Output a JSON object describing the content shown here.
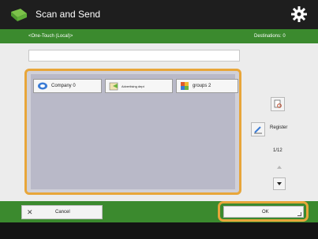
{
  "titlebar": {
    "title": "Scan and Send",
    "app_icon": "scan-send-icon",
    "settings_icon": "gear-icon"
  },
  "subbar": {
    "breadcrumb": "<One-Touch (Local)>",
    "destinations": "Destinations:  0"
  },
  "search": {
    "value": ""
  },
  "entries": [
    {
      "label": "Company  0",
      "icon": "company-icon"
    },
    {
      "label": "Advertising dept",
      "icon": "department-icon"
    },
    {
      "label": "groups 2",
      "icon": "group-icon"
    }
  ],
  "side": {
    "register_label": "Register",
    "page": "1/12"
  },
  "bottom": {
    "cancel_label": "Cancel",
    "ok_label": "OK"
  },
  "colors": {
    "accent_green": "#3b8a2e",
    "highlight_orange": "#e8a63a"
  }
}
